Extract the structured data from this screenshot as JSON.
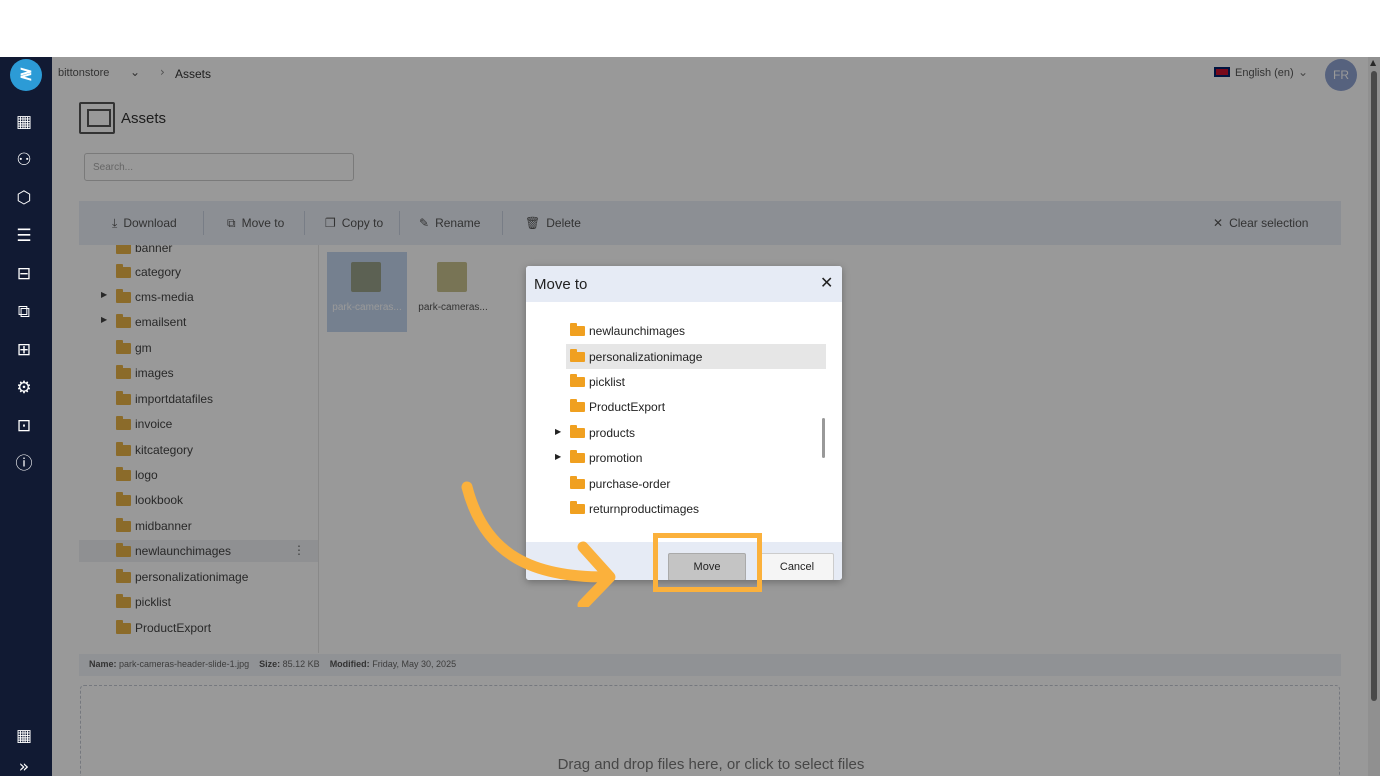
{
  "topbar": {
    "store": "bittonstore",
    "breadcrumb": "Assets",
    "language": "English (en)",
    "avatar_initials": "FR"
  },
  "page": {
    "title": "Assets",
    "search_placeholder": "Search..."
  },
  "toolbar": {
    "download": "Download",
    "move_to": "Move to",
    "copy_to": "Copy to",
    "rename": "Rename",
    "delete": "Delete",
    "clear_selection": "Clear selection"
  },
  "tree": {
    "items": [
      {
        "label": "banner"
      },
      {
        "label": "category"
      },
      {
        "label": "cms-media"
      },
      {
        "label": "emailsent"
      },
      {
        "label": "gm"
      },
      {
        "label": "images"
      },
      {
        "label": "importdatafiles"
      },
      {
        "label": "invoice"
      },
      {
        "label": "kitcategory"
      },
      {
        "label": "logo"
      },
      {
        "label": "lookbook"
      },
      {
        "label": "midbanner"
      },
      {
        "label": "newlaunchimages"
      },
      {
        "label": "personalizationimage"
      },
      {
        "label": "picklist"
      },
      {
        "label": "ProductExport"
      }
    ]
  },
  "files": [
    {
      "name": "park-cameras..."
    },
    {
      "name": "park-cameras..."
    }
  ],
  "info": {
    "name_label": "Name:",
    "name_value": "park-cameras-header-slide-1.jpg",
    "size_label": "Size:",
    "size_value": "85.12 KB",
    "modified_label": "Modified:",
    "modified_value": "Friday, May 30, 2025"
  },
  "dropzone": {
    "text": "Drag and drop files here, or click to select files"
  },
  "modal": {
    "title": "Move to",
    "items": [
      {
        "label": "newlaunchimages"
      },
      {
        "label": "personalizationimage"
      },
      {
        "label": "picklist"
      },
      {
        "label": "ProductExport"
      },
      {
        "label": "products"
      },
      {
        "label": "promotion"
      },
      {
        "label": "purchase-order"
      },
      {
        "label": "returnproductimages"
      }
    ],
    "move_button": "Move",
    "cancel_button": "Cancel"
  },
  "colors": {
    "sidebar": "#111a33",
    "highlight": "#fbb13c",
    "folder": "#f0a020"
  }
}
